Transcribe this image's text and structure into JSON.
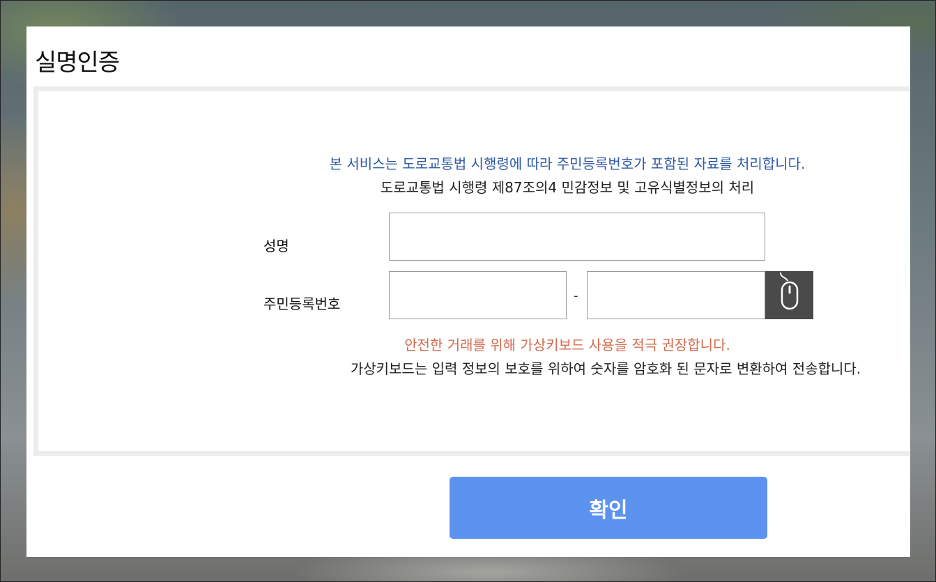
{
  "modal": {
    "title": "실명인증"
  },
  "notice": {
    "line1": "본 서비스는 도로교통법 시행령에 따라 주민등록번호가 포함된 자료를 처리합니다.",
    "line2": "도로교통법 시행령 제87조의4 민감정보 및 고유식별정보의 처리"
  },
  "form": {
    "name_label": "성명",
    "name_value": "",
    "rrn_label": "주민등록번호",
    "rrn_front_value": "",
    "rrn_separator": "-",
    "rrn_back_value": "",
    "virtual_keyboard_icon": "mouse-icon"
  },
  "keyboard_notice": {
    "warning": "안전한 거래를 위해 가상키보드 사용을 적극 권장합니다.",
    "info": "가상키보드는 입력 정보의 보호를 위하여 숫자를 암호화 된 문자로 변환하여 전송합니다."
  },
  "actions": {
    "confirm_label": "확인"
  },
  "colors": {
    "notice_blue": "#2f5aa6",
    "notice_red": "#d06b4f",
    "confirm_button": "#5b93ef",
    "vk_button": "#4a4a4a"
  }
}
